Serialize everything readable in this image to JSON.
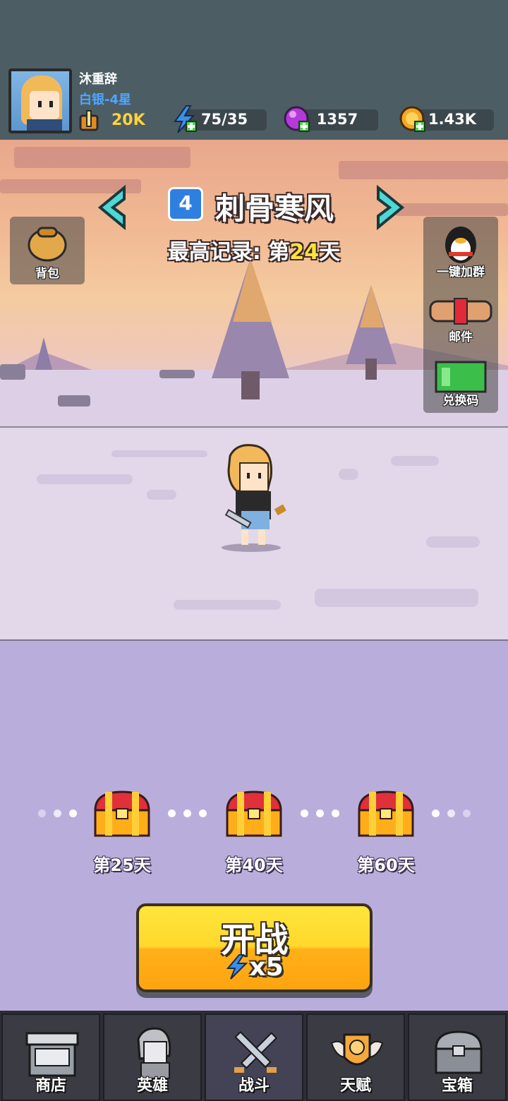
{
  "player": {
    "name": "沐重辞",
    "rank": "白银-4星",
    "power": "20K"
  },
  "resources": [
    {
      "icon": "energy-icon",
      "value": "75/35",
      "color": "#3a8fe8"
    },
    {
      "icon": "gem-icon",
      "value": "1357",
      "color": "#b33ad8"
    },
    {
      "icon": "coin-icon",
      "value": "1.43K",
      "color": "#f5a623"
    }
  ],
  "stage": {
    "number": "4",
    "name": "刺骨寒风",
    "record_prefix": "最高记录: 第",
    "record_day": "24",
    "record_suffix": "天"
  },
  "side_buttons": {
    "backpack": "背包",
    "join_group": "一键加群",
    "mail": "邮件",
    "redeem": "兑换码"
  },
  "rewards": [
    {
      "label": "第25天"
    },
    {
      "label": "第40天"
    },
    {
      "label": "第60天"
    }
  ],
  "fight_button": {
    "label": "开战",
    "cost": "x5"
  },
  "nav": [
    {
      "label": "商店",
      "icon": "shop-icon"
    },
    {
      "label": "英雄",
      "icon": "hero-icon"
    },
    {
      "label": "战斗",
      "icon": "swords-icon"
    },
    {
      "label": "天赋",
      "icon": "talent-icon"
    },
    {
      "label": "宝箱",
      "icon": "chest-icon"
    }
  ],
  "colors": {
    "accent_blue": "#2f7fe0",
    "highlight_yellow": "#ffe23a",
    "button_yellow": "#ffd82c"
  }
}
